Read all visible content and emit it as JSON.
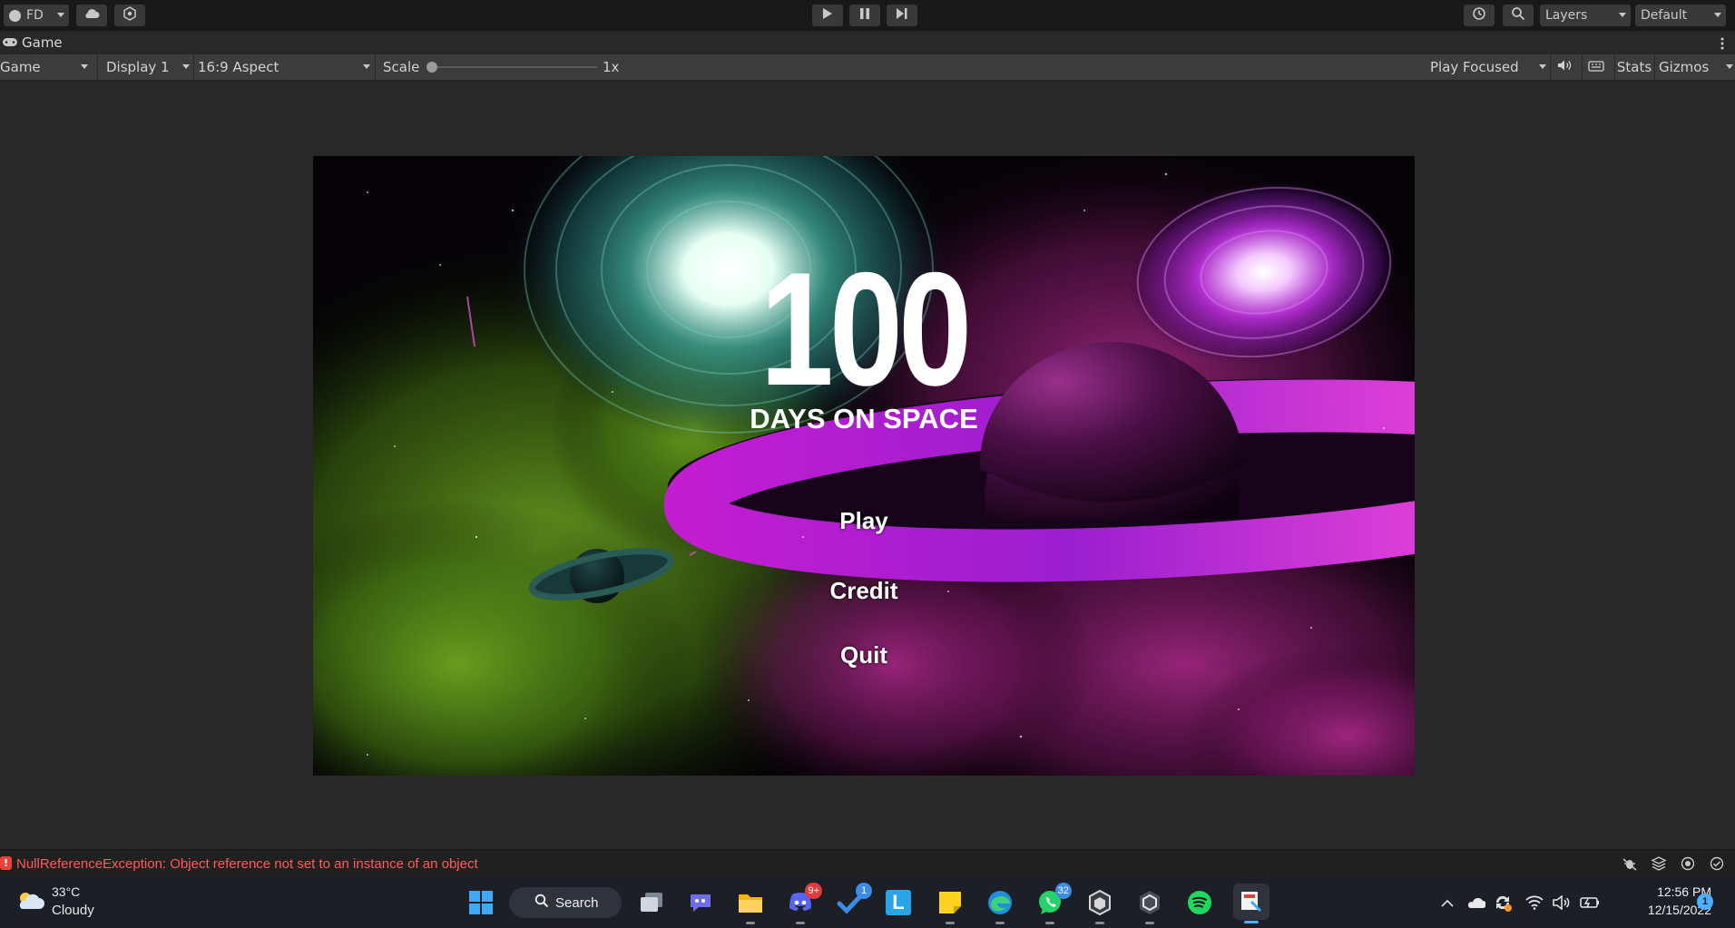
{
  "topbar": {
    "account_label": "FD",
    "layers_label": "Layers",
    "layout_label": "Default"
  },
  "game_tab": {
    "label": "Game"
  },
  "toolbar": {
    "view_mode": "Game",
    "display": "Display 1",
    "aspect": "16:9 Aspect",
    "scale_label": "Scale",
    "scale_value": "1x",
    "scale_level": 0,
    "play_mode": "Play Focused",
    "stats_label": "Stats",
    "gizmos_label": "Gizmos"
  },
  "game": {
    "title_number": "100",
    "title_sub": "DAYS ON SPACE",
    "menu": {
      "play": "Play",
      "credit": "Credit",
      "quit": "Quit"
    }
  },
  "status": {
    "error_message": "NullReferenceException: Object reference not set to an instance of an object",
    "error_color": "#ff5b5b"
  },
  "taskbar": {
    "weather_temp": "33°C",
    "weather_desc": "Cloudy",
    "search_label": "Search",
    "discord_badge": "9+",
    "todo_badge": "1",
    "whatsapp_badge": "32",
    "time": "12:56 PM",
    "date": "12/15/2022",
    "notification_count": "1",
    "icons": [
      "windows-start-icon",
      "search-icon",
      "task-view-icon",
      "teams-chat-icon",
      "file-explorer-icon",
      "discord-icon",
      "todo-icon",
      "launcher-l-icon",
      "sticky-notes-icon",
      "edge-icon",
      "whatsapp-icon",
      "unity-hub-icon",
      "unity-icon",
      "spotify-icon",
      "paint-icon"
    ]
  }
}
